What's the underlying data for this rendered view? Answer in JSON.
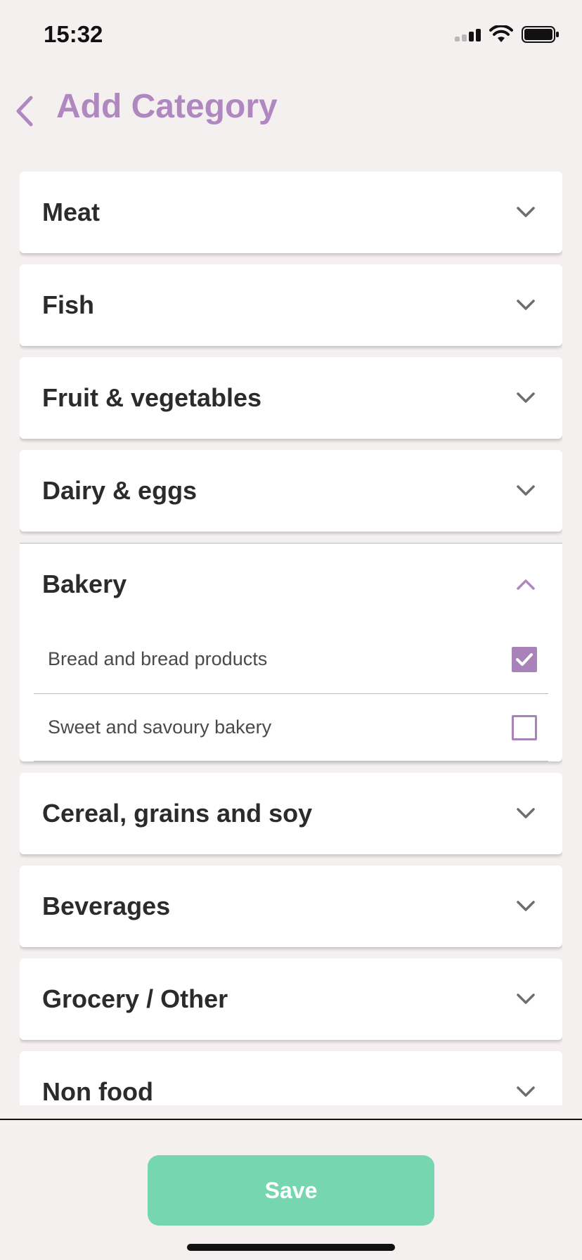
{
  "status_bar": {
    "time": "15:32",
    "icons": [
      "signal-icon",
      "wifi-icon",
      "battery-icon"
    ]
  },
  "header": {
    "back_icon": "chevron-left-icon",
    "title": "Add Category"
  },
  "colors": {
    "accent": "#b088c0",
    "checkbox": "#a882b8",
    "save": "#76d6b0",
    "background": "#f5f0f0"
  },
  "categories": [
    {
      "label": "Meat",
      "expanded": false
    },
    {
      "label": "Fish",
      "expanded": false
    },
    {
      "label": "Fruit & vegetables",
      "expanded": false
    },
    {
      "label": "Dairy & eggs",
      "expanded": false
    },
    {
      "label": "Bakery",
      "expanded": true,
      "items": [
        {
          "label": "Bread and bread products",
          "checked": true
        },
        {
          "label": "Sweet and savoury bakery",
          "checked": false
        }
      ]
    },
    {
      "label": "Cereal, grains and soy",
      "expanded": false
    },
    {
      "label": "Beverages",
      "expanded": false
    },
    {
      "label": "Grocery / Other",
      "expanded": false
    },
    {
      "label": "Non food",
      "expanded": false
    }
  ],
  "footer": {
    "save_label": "Save"
  }
}
